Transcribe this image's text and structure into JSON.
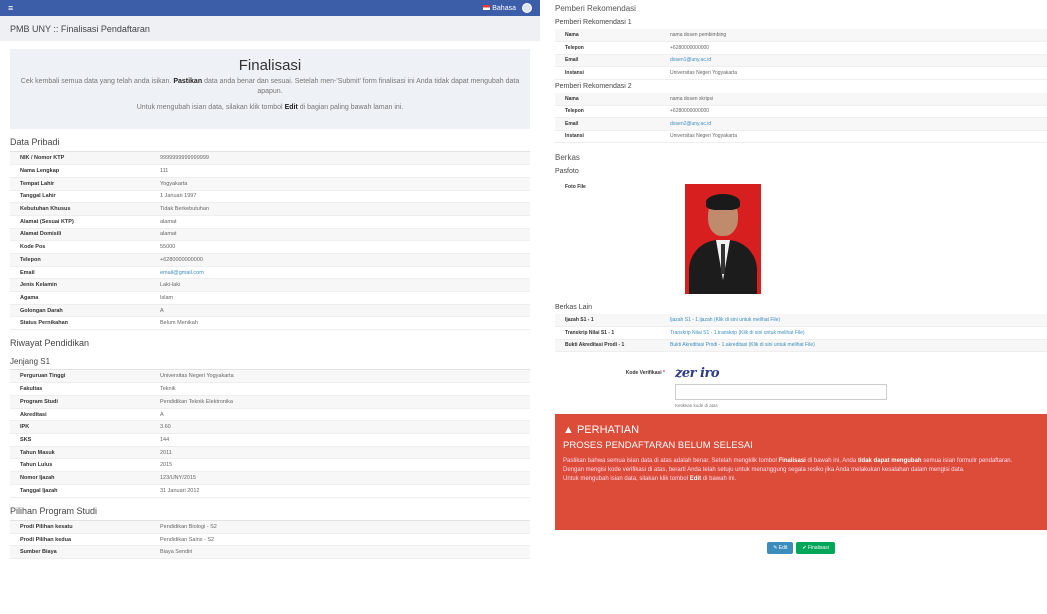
{
  "topbar": {
    "menu_icon": "≡",
    "language": "Bahasa"
  },
  "breadcrumb": "PMB UNY :: Finalisasi Pendaftaran",
  "intro": {
    "title": "Finalisasi",
    "line1_pre": "Cek kembali semua data yang telah anda isikan.",
    "line1_bold": "Pastikan",
    "line1_post": "data anda benar dan sesuai. Setelah men-'Submit' form finalisasi ini Anda tidak dapat mengubah data apapun.",
    "line2_pre": "Untuk mengubah isian data, silakan klik tombol",
    "line2_bold": "Edit",
    "line2_post": "di bagian paling bawah laman ini."
  },
  "pribadi": {
    "title": "Data Pribadi",
    "rows": [
      {
        "k": "NIK / Nomor KTP",
        "v": "9999999999999999"
      },
      {
        "k": "Nama Lengkap",
        "v": "111"
      },
      {
        "k": "Tempat Lahir",
        "v": "Yogyakarta"
      },
      {
        "k": "Tanggal Lahir",
        "v": "1 Januari 1997"
      },
      {
        "k": "Kebutuhan Khusus",
        "v": "Tidak Berkebutuhan"
      },
      {
        "k": "Alamat (Sesuai KTP)",
        "v": "alamat"
      },
      {
        "k": "Alamat Domisili",
        "v": "alamat"
      },
      {
        "k": "Kode Pos",
        "v": "55000"
      },
      {
        "k": "Telepon",
        "v": "+6280000000000"
      },
      {
        "k": "Email",
        "v": "email@gmail.com"
      },
      {
        "k": "Jenis Kelamin",
        "v": "Laki-laki"
      },
      {
        "k": "Agama",
        "v": "Islam"
      },
      {
        "k": "Golongan Darah",
        "v": "A"
      },
      {
        "k": "Status Pernikahan",
        "v": "Belum Menikah"
      }
    ]
  },
  "pendidikan": {
    "title": "Riwayat Pendidikan",
    "jenjang": "Jenjang S1",
    "rows": [
      {
        "k": "Perguruan Tinggi",
        "v": "Universitas Negeri Yogyakarta"
      },
      {
        "k": "Fakultas",
        "v": "Teknik"
      },
      {
        "k": "Program Studi",
        "v": "Pendidikan Teknik Elektronika"
      },
      {
        "k": "Akreditasi",
        "v": "A"
      },
      {
        "k": "IPK",
        "v": "3.60"
      },
      {
        "k": "SKS",
        "v": "144"
      },
      {
        "k": "Tahun Masuk",
        "v": "2011"
      },
      {
        "k": "Tahun Lulus",
        "v": "2015"
      },
      {
        "k": "Nomor Ijazah",
        "v": "123/UNY/2015"
      },
      {
        "k": "Tanggal Ijazah",
        "v": "31 Januari 2012"
      }
    ]
  },
  "pilihan": {
    "title": "Pilihan Program Studi",
    "rows": [
      {
        "k": "Prodi Pilihan kesatu",
        "v": "Pendidikan Biologi - S2"
      },
      {
        "k": "Prodi Pilihan kedua",
        "v": "Pendidikan Sains - S2"
      },
      {
        "k": "Sumber Biaya",
        "v": "Biaya Sendiri"
      }
    ]
  },
  "rekomendasi": {
    "title": "Pemberi Rekomendasi",
    "r1_title": "Pemberi Rekomendasi 1",
    "r1": [
      {
        "k": "Nama",
        "v": "nama dosen pembimbing"
      },
      {
        "k": "Telepon",
        "v": "+6280000000000"
      },
      {
        "k": "Email",
        "v": "dosen1@uny.ac.id"
      },
      {
        "k": "Instansi",
        "v": "Universitas Negeri Yogyakarta"
      }
    ],
    "r2_title": "Pemberi Rekomendasi 2",
    "r2": [
      {
        "k": "Nama",
        "v": "nama dosen skripsi"
      },
      {
        "k": "Telepon",
        "v": "+6280000000000"
      },
      {
        "k": "Email",
        "v": "dosen2@uny.ac.id"
      },
      {
        "k": "Instansi",
        "v": "Universitas Negeri Yogyakarta"
      }
    ]
  },
  "berkas": {
    "title": "Berkas",
    "pasfoto": "Pasfoto",
    "foto_label": "Foto File",
    "lain_title": "Berkas Lain",
    "lain": [
      {
        "k": "Ijazah S1 - 1",
        "v": "Ijazah S1 - 1.ijazah (Klik di sini untuk melihat File)"
      },
      {
        "k": "Transkrip Nilai S1 - 1",
        "v": "Transkrip Nilai S1 - 1.transkrip (Klik di sini untuk melihat File)"
      },
      {
        "k": "Bukti Akreditasi Prodi - 1",
        "v": "Bukti Akreditasi Prodi - 1.akreditasi (Klik di sini untuk melihat File)"
      }
    ]
  },
  "verifikasi": {
    "label": "Kode Verifikasi",
    "req": "*",
    "captcha": "zer iro",
    "help": "Ketikkan kode di atas"
  },
  "alert": {
    "title": "PERHATIAN",
    "subtitle": "PROSES PENDAFTARAN BELUM SELESAI",
    "p1_a": "Pastikan bahwa semua isian data di atas adalah benar. Setelah mengklik tombol",
    "p1_b": "Finalisasi",
    "p1_c": "di bawah ini, Anda",
    "p1_d": "tidak dapat mengubah",
    "p1_e": "semua isian formulir pendaftaran.",
    "p2": "Dengan mengisi kode verifikasi di atas, berarti Anda telah setuju untuk menanggung segala resiko jika Anda melakukan kesalahan dalam mengisi data.",
    "p3_a": "Untuk mengubah isian data, silakan klik tombol",
    "p3_b": "Edit",
    "p3_c": "di bawah ini."
  },
  "buttons": {
    "edit": "✎ Edit",
    "finalisasi": "✔ Finalisasi"
  }
}
